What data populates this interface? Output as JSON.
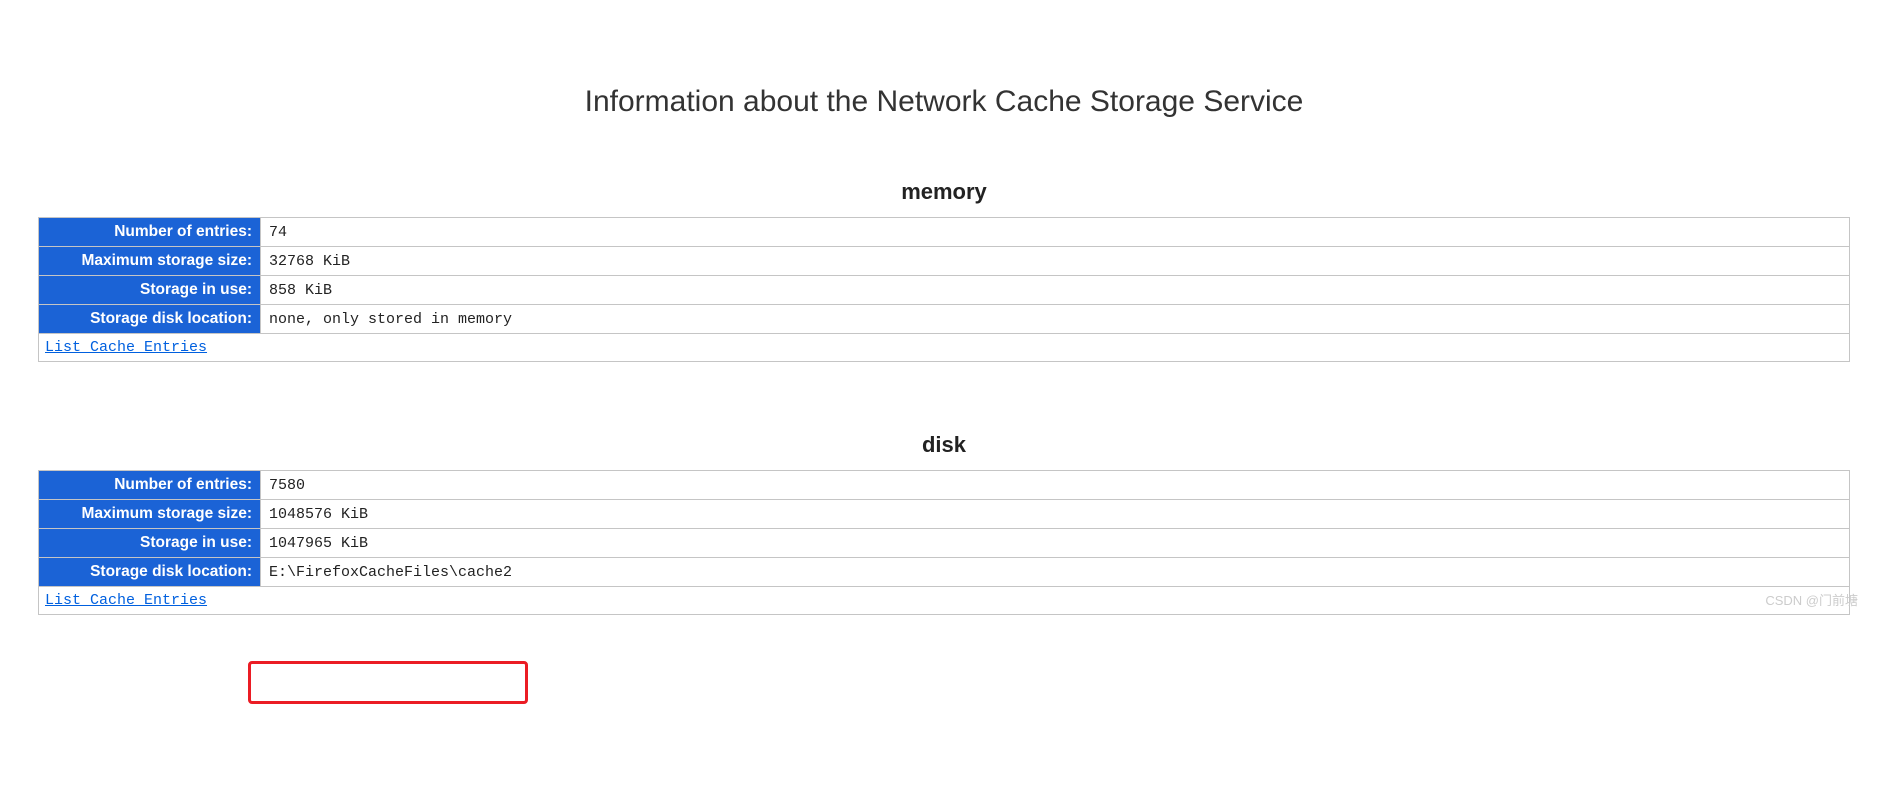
{
  "title": "Information about the Network Cache Storage Service",
  "sections": {
    "memory": {
      "heading": "memory",
      "rows": {
        "entries": {
          "label": "Number of entries:",
          "value": "74"
        },
        "maxsize": {
          "label": "Maximum storage size:",
          "value": "32768 KiB"
        },
        "inuse": {
          "label": "Storage in use:",
          "value": "858 KiB"
        },
        "location": {
          "label": "Storage disk location:",
          "value": "none, only stored in memory"
        }
      },
      "link": "List Cache Entries"
    },
    "disk": {
      "heading": "disk",
      "rows": {
        "entries": {
          "label": "Number of entries:",
          "value": "7580"
        },
        "maxsize": {
          "label": "Maximum storage size:",
          "value": "1048576 KiB"
        },
        "inuse": {
          "label": "Storage in use:",
          "value": "1047965 KiB"
        },
        "location": {
          "label": "Storage disk location:",
          "value": "E:\\FirefoxCacheFiles\\cache2"
        }
      },
      "link": "List Cache Entries"
    }
  },
  "watermark": "CSDN @门前塘"
}
